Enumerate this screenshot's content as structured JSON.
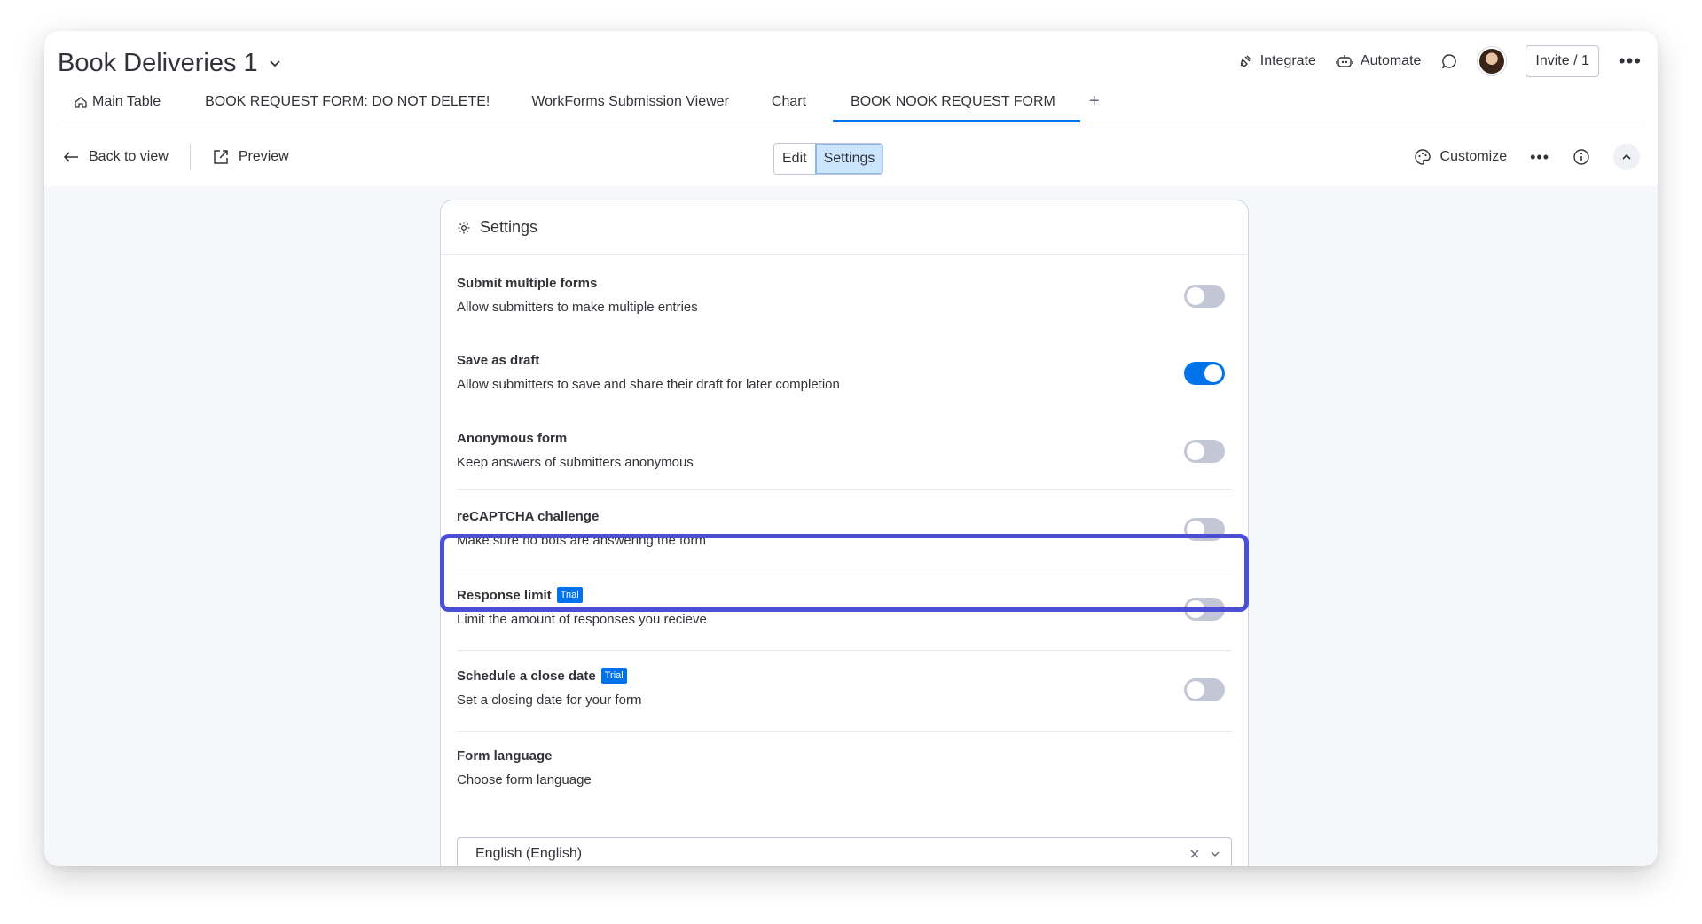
{
  "board": {
    "title": "Book Deliveries 1"
  },
  "header_actions": {
    "integrate": "Integrate",
    "automate": "Automate",
    "invite": "Invite / 1"
  },
  "tabs": [
    {
      "label": "Main Table"
    },
    {
      "label": "BOOK REQUEST FORM: DO NOT DELETE!"
    },
    {
      "label": "WorkForms Submission Viewer"
    },
    {
      "label": "Chart"
    },
    {
      "label": "BOOK NOOK REQUEST FORM"
    }
  ],
  "tab_add": "+",
  "toolbar": {
    "back": "Back to view",
    "preview": "Preview",
    "edit": "Edit",
    "settings": "Settings",
    "customize": "Customize"
  },
  "settings_panel": {
    "title": "Settings",
    "items": [
      {
        "title": "Submit multiple forms",
        "description": "Allow submitters to make multiple entries",
        "enabled": false
      },
      {
        "title": "Save as draft",
        "description": "Allow submitters to save and share their draft for later completion",
        "enabled": true
      },
      {
        "title": "Anonymous form",
        "description": "Keep answers of submitters anonymous",
        "enabled": false
      },
      {
        "title": "reCAPTCHA challenge",
        "description": "Make sure no bots are answering the form",
        "enabled": false
      },
      {
        "title": "Response limit",
        "badge": "Trial",
        "description": "Limit the amount of responses you recieve",
        "enabled": false
      },
      {
        "title": "Schedule a close date",
        "badge": "Trial",
        "description": "Set a closing date for your form",
        "enabled": false
      }
    ],
    "language": {
      "title": "Form language",
      "description": "Choose form language",
      "selected": "English (English)"
    }
  },
  "colors": {
    "accent": "#0073ea",
    "highlight": "#4b4fd6"
  }
}
